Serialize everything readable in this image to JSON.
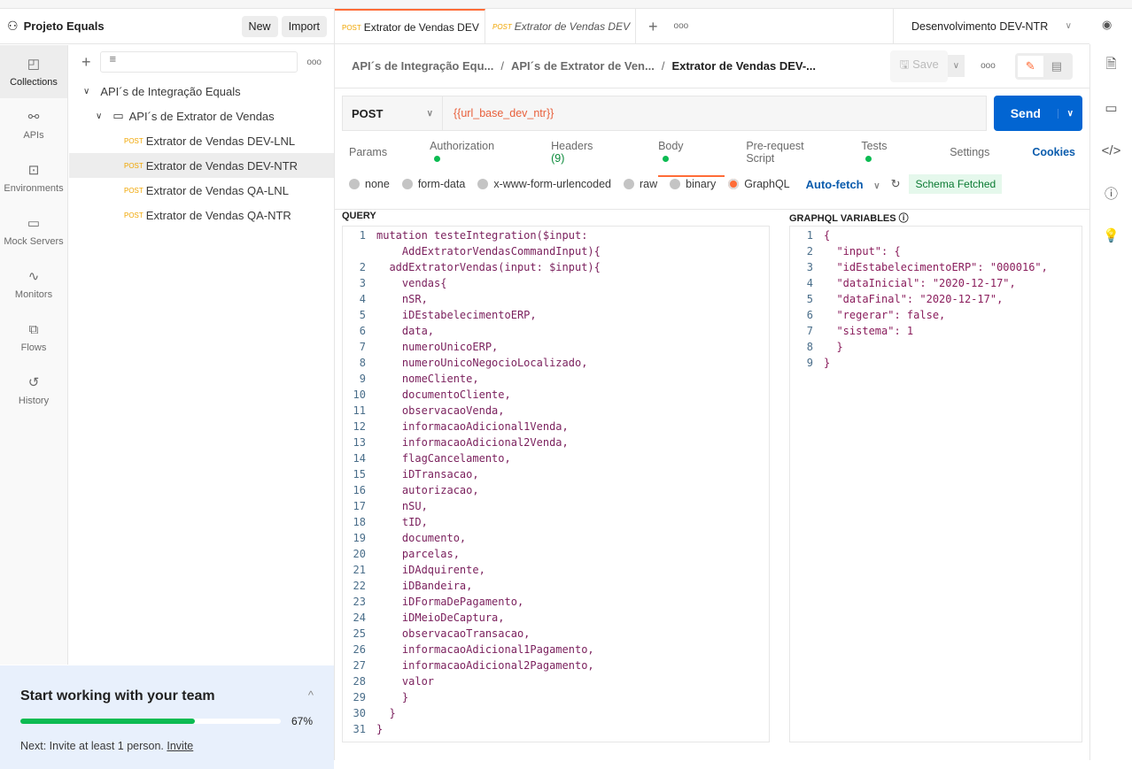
{
  "workspace": {
    "title": "Projeto Equals",
    "new_label": "New",
    "import_label": "Import"
  },
  "rail": [
    {
      "label": "Collections",
      "icon": "collections-icon"
    },
    {
      "label": "APIs",
      "icon": "apis-icon"
    },
    {
      "label": "Environments",
      "icon": "environments-icon"
    },
    {
      "label": "Mock Servers",
      "icon": "mock-servers-icon"
    },
    {
      "label": "Monitors",
      "icon": "monitors-icon"
    },
    {
      "label": "Flows",
      "icon": "flows-icon"
    },
    {
      "label": "History",
      "icon": "history-icon"
    }
  ],
  "tree": {
    "collection": "API´s de Integração Equals",
    "folder": "API´s de Extrator de Vendas",
    "requests": [
      {
        "method": "POST",
        "name": "Extrator de Vendas DEV-LNL"
      },
      {
        "method": "POST",
        "name": "Extrator de Vendas DEV-NTR",
        "selected": true
      },
      {
        "method": "POST",
        "name": "Extrator de Vendas QA-LNL"
      },
      {
        "method": "POST",
        "name": "Extrator de Vendas QA-NTR"
      }
    ]
  },
  "team": {
    "title": "Start working with your team",
    "progress": 67,
    "progress_label": "67%",
    "next_text": "Next: Invite at least 1 person.",
    "invite_link": "Invite"
  },
  "tabs": [
    {
      "method": "POST",
      "name": "Extrator de Vendas DEV",
      "active": true
    },
    {
      "method": "POST",
      "name": "Extrator de Vendas DEV",
      "italic": true
    }
  ],
  "environment": "Desenvolvimento DEV-NTR",
  "breadcrumb": [
    "API´s de Integração Equ...",
    "API´s de Extrator de Ven...",
    "Extrator de Vendas DEV-..."
  ],
  "save_label": "Save",
  "request": {
    "method": "POST",
    "url": "{{url_base_dev_ntr}}",
    "send_label": "Send"
  },
  "req_tabs": [
    {
      "label": "Params"
    },
    {
      "label": "Authorization",
      "dot": true
    },
    {
      "label": "Headers",
      "count": "(9)"
    },
    {
      "label": "Body",
      "dot": true,
      "active": true
    },
    {
      "label": "Pre-request Script"
    },
    {
      "label": "Tests",
      "dot": true
    },
    {
      "label": "Settings"
    }
  ],
  "cookies_label": "Cookies",
  "body_types": [
    "none",
    "form-data",
    "x-www-form-urlencoded",
    "raw",
    "binary",
    "GraphQL"
  ],
  "body_selected": "GraphQL",
  "auto_fetch": "Auto-fetch",
  "schema_status": "Schema Fetched",
  "query_label": "QUERY",
  "variables_label": "GRAPHQL VARIABLES",
  "colors": {
    "accent": "#ff6c37",
    "send": "#0265d2",
    "green": "#0cbb52",
    "link": "#0b5cad"
  },
  "query_lines": [
    {
      "n": "1",
      "text": "mutation testeIntegration($input:"
    },
    {
      "n": "",
      "text": "    AddExtratorVendasCommandInput){"
    },
    {
      "n": "2",
      "text": "  addExtratorVendas(input: $input){"
    },
    {
      "n": "3",
      "text": "    vendas{"
    },
    {
      "n": "4",
      "text": "    nSR,"
    },
    {
      "n": "5",
      "text": "    iDEstabelecimentoERP,"
    },
    {
      "n": "6",
      "text": "    data,"
    },
    {
      "n": "7",
      "text": "    numeroUnicoERP,"
    },
    {
      "n": "8",
      "text": "    numeroUnicoNegocioLocalizado,"
    },
    {
      "n": "9",
      "text": "    nomeCliente,"
    },
    {
      "n": "10",
      "text": "    documentoCliente,"
    },
    {
      "n": "11",
      "text": "    observacaoVenda,"
    },
    {
      "n": "12",
      "text": "    informacaoAdicional1Venda,"
    },
    {
      "n": "13",
      "text": "    informacaoAdicional2Venda,"
    },
    {
      "n": "14",
      "text": "    flagCancelamento,"
    },
    {
      "n": "15",
      "text": "    iDTransacao,"
    },
    {
      "n": "16",
      "text": "    autorizacao,"
    },
    {
      "n": "17",
      "text": "    nSU,"
    },
    {
      "n": "18",
      "text": "    tID,"
    },
    {
      "n": "19",
      "text": "    documento,"
    },
    {
      "n": "20",
      "text": "    parcelas,"
    },
    {
      "n": "21",
      "text": "    iDAdquirente,"
    },
    {
      "n": "22",
      "text": "    iDBandeira,"
    },
    {
      "n": "23",
      "text": "    iDFormaDePagamento,"
    },
    {
      "n": "24",
      "text": "    iDMeioDeCaptura,"
    },
    {
      "n": "25",
      "text": "    observacaoTransacao,"
    },
    {
      "n": "26",
      "text": "    informacaoAdicional1Pagamento,"
    },
    {
      "n": "27",
      "text": "    informacaoAdicional2Pagamento,"
    },
    {
      "n": "28",
      "text": "    valor"
    },
    {
      "n": "29",
      "text": "    }"
    },
    {
      "n": "30",
      "text": "  }"
    },
    {
      "n": "31",
      "text": "}"
    }
  ],
  "variable_lines": [
    {
      "n": "1",
      "text": "{"
    },
    {
      "n": "2",
      "text": "  \"input\": {"
    },
    {
      "n": "3",
      "text": "  \"idEstabelecimentoERP\": \"000016\","
    },
    {
      "n": "4",
      "text": "  \"dataInicial\": \"2020-12-17\","
    },
    {
      "n": "5",
      "text": "  \"dataFinal\": \"2020-12-17\","
    },
    {
      "n": "6",
      "text": "  \"regerar\": false,"
    },
    {
      "n": "7",
      "text": "  \"sistema\": 1"
    },
    {
      "n": "8",
      "text": "  }"
    },
    {
      "n": "9",
      "text": "}"
    }
  ]
}
